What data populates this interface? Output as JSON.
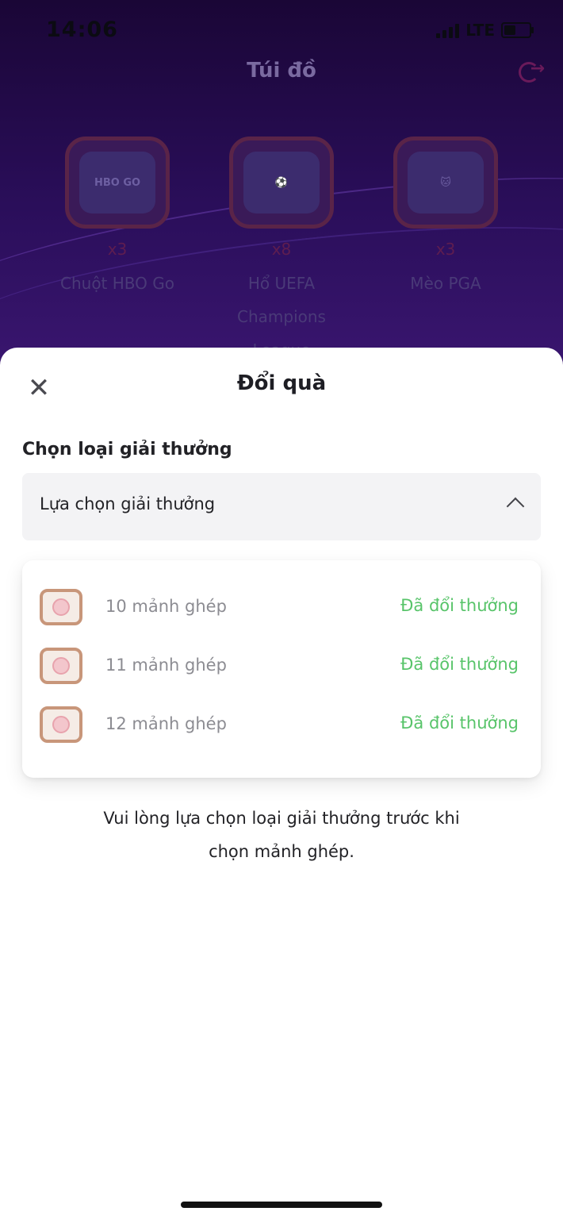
{
  "status": {
    "time": "14:06",
    "network": "LTE"
  },
  "bag": {
    "title": "Túi đồ",
    "items": [
      {
        "badge": "HBO GO",
        "qty": "x3",
        "name": "Chuột HBO Go"
      },
      {
        "badge": "",
        "qty": "x8",
        "name": "Hổ UEFA Champions League"
      },
      {
        "badge": "",
        "qty": "x3",
        "name": "Mèo PGA"
      }
    ]
  },
  "sheet": {
    "title": "Đổi quà",
    "section_label": "Chọn loại giải thưởng",
    "select_value": "Lựa chọn giải thưởng",
    "options": [
      {
        "label": "10 mảnh ghép",
        "status": "Đã đổi thưởng"
      },
      {
        "label": "11 mảnh ghép",
        "status": "Đã đổi thưởng"
      },
      {
        "label": "12 mảnh ghép",
        "status": "Đã đổi thưởng"
      }
    ],
    "hint_line1": "Vui lòng lựa chọn loại giải thưởng trước khi",
    "hint_line2": "chọn mảnh ghép."
  },
  "colors": {
    "accent_green": "#58c46a",
    "bg_purple": "#2a0e5a"
  }
}
